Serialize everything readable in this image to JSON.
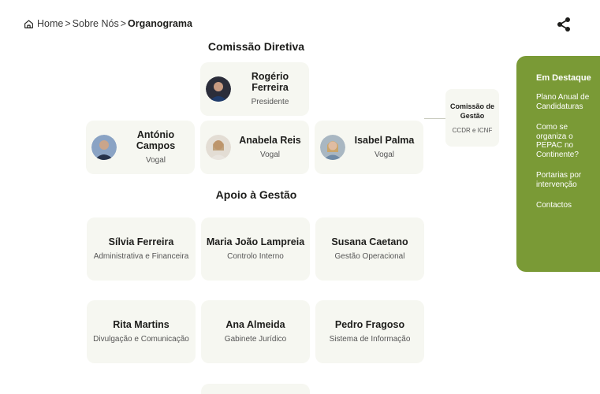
{
  "breadcrumb": {
    "home": "Home",
    "sep1": ">",
    "about": "Sobre Nós",
    "sep2": ">",
    "current": "Organograma"
  },
  "icons": {
    "home": "home-icon",
    "share": "share-icon"
  },
  "sections": {
    "direction": "Comissão Diretiva",
    "support": "Apoio à Gestão"
  },
  "direction": {
    "president": {
      "name": "Rogério Ferreira",
      "role": "Presidente"
    },
    "members": [
      {
        "name": "António Campos",
        "role": "Vogal"
      },
      {
        "name": "Anabela Reis",
        "role": "Vogal"
      },
      {
        "name": "Isabel Palma",
        "role": "Vogal"
      }
    ]
  },
  "side_card": {
    "title": "Comissão de Gestão",
    "subtitle": "CCDR e ICNF"
  },
  "support": [
    {
      "name": "Sílvia Ferreira",
      "role": "Administrativa e Financeira"
    },
    {
      "name": "Maria João Lampreia",
      "role": "Controlo Interno"
    },
    {
      "name": "Susana Caetano",
      "role": "Gestão Operacional"
    },
    {
      "name": "Rita Martins",
      "role": "Divulgação e Comunicação"
    },
    {
      "name": "Ana Almeida",
      "role": "Gabinete Jurídico"
    },
    {
      "name": "Pedro Fragoso",
      "role": "Sistema de Informação"
    }
  ],
  "highlight": {
    "title": "Em Destaque",
    "links": [
      "Plano Anual de Candidaturas",
      "Como se organiza o PEPAC no Continente?",
      "Portarias por intervenção",
      "Contactos"
    ]
  },
  "colors": {
    "accent": "#7a9a36",
    "card_bg": "#f6f7f1"
  }
}
